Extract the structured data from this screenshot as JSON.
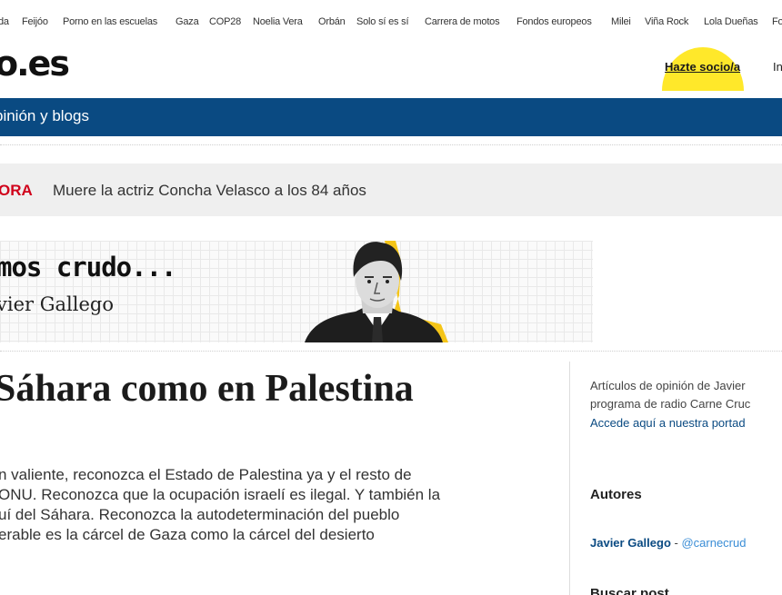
{
  "topics": [
    "da",
    "Feijóo",
    "Porno en las escuelas",
    "Gaza",
    "COP28",
    "Noelia Vera",
    "Orbán",
    "Solo sí es sí",
    "Carrera de motos",
    "Fondos europeos",
    "Milei",
    "Viña Rock",
    "Lola Dueñas",
    "Fo"
  ],
  "header": {
    "brand": "o.es",
    "socio_label": "Hazte socio/a",
    "login_label": "In"
  },
  "nav": {
    "section": "pinión y blogs"
  },
  "breaking": {
    "tag": "ORA",
    "headline": "Muere la actriz Concha Velasco a los 84 años"
  },
  "blog_banner": {
    "title": "mos crudo...",
    "author": "vier Gallego"
  },
  "article": {
    "title": "Sáhara como en Palestina",
    "lead": [
      "n valiente, reconozca el Estado de Palestina ya y el resto de",
      "ONU. Reconozca que la ocupación israelí es ilegal. Y también la",
      "uí del Sáhara. Reconozca la autodeterminación del pueblo",
      "erable es la cárcel de Gaza como la cárcel del desierto"
    ]
  },
  "sidebar": {
    "desc_lines": [
      "Artículos de opinión de Javier",
      "programa de radio Carne Cruc"
    ],
    "portada_link": "Accede aquí a nuestra portad",
    "autores_heading": "Autores",
    "author_name": "Javier Gallego",
    "author_sep": " - ",
    "author_handle": "@carnecrud",
    "search_heading": "Buscar post"
  },
  "colors": {
    "nav_blue": "#0a4a82",
    "breaking_red": "#d0021b",
    "socio_yellow": "#ffe82a"
  }
}
